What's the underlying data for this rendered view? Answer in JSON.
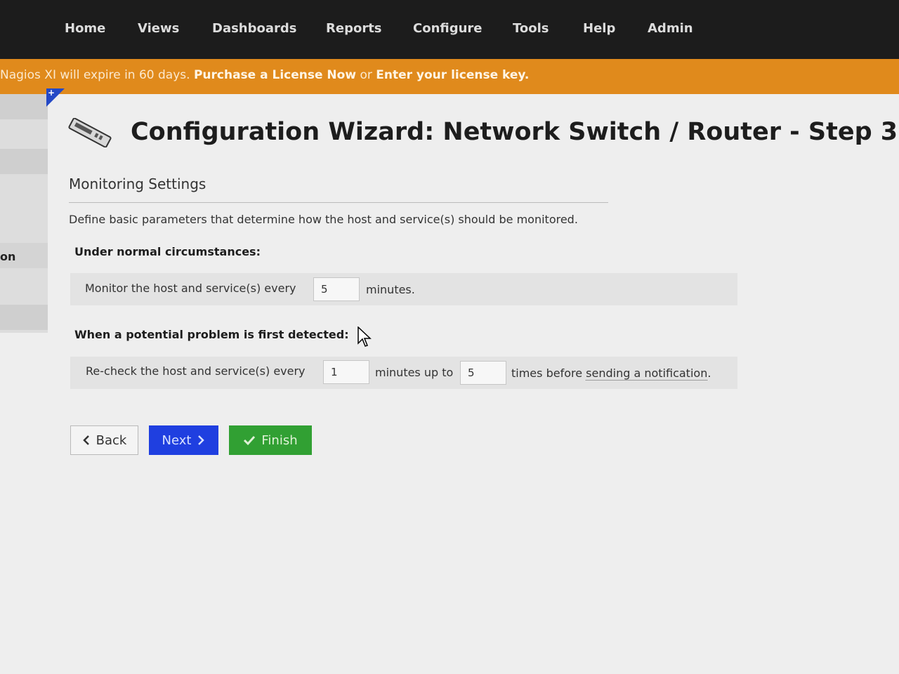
{
  "nav": {
    "items": [
      "Home",
      "Views",
      "Dashboards",
      "Reports",
      "Configure",
      "Tools",
      "Help",
      "Admin"
    ]
  },
  "banner": {
    "prefix": "Nagios XI will expire in 60 days.",
    "purchase_link": "Purchase a License Now",
    "or": "or",
    "enter_link": "Enter your license key."
  },
  "sidebar": {
    "partial_label": "on",
    "toggle_icon": "+"
  },
  "page": {
    "title": "Configuration Wizard: Network Switch / Router - Step 3",
    "icon": "network-switch-icon"
  },
  "monitoring": {
    "section_title": "Monitoring Settings",
    "description": "Define basic parameters that determine how the host and service(s) should be monitored.",
    "normal": {
      "heading": "Under normal circumstances:",
      "text_before": "Monitor the host and service(s) every",
      "interval_value": "5",
      "text_after": "minutes."
    },
    "problem": {
      "heading": "When a potential problem is first detected:",
      "text_before": "Re-check the host and service(s) every",
      "retry_value": "1",
      "text_middle": "minutes up to",
      "attempts_value": "5",
      "text_after_a": "times before",
      "text_after_link": "sending a notification",
      "text_after_end": "."
    }
  },
  "buttons": {
    "back": "Back",
    "next": "Next",
    "finish": "Finish"
  },
  "colors": {
    "nav_bg": "#1c1c1c",
    "banner_bg": "#e08a1c",
    "next_button": "#1f3fe0",
    "finish_button": "#31a033"
  }
}
